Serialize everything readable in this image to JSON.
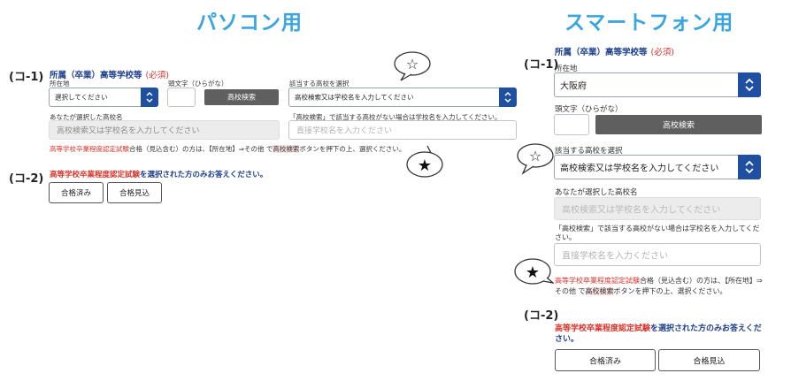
{
  "headings": {
    "pc": "パソコン用",
    "sp": "スマートフォン用"
  },
  "markers": {
    "k1": "(コ-1)",
    "k2": "(コ-2)"
  },
  "section1": {
    "title": "所属（卒業）高等学校等",
    "required": "(必須)",
    "prefecture_label": "所在地",
    "prefecture_value_pc": "選択してください",
    "prefecture_value_sp": "大阪府",
    "initial_label": "頭文字（ひらがな）",
    "search_button": "高校検索",
    "school_select_label": "該当する高校を選択",
    "school_select_value": "高校検索又は学校名を入力してください",
    "selected_label": "あなたが選択した高校名",
    "selected_placeholder": "高校検索又は学校名を入力してください",
    "direct_hint": "「高校検索」で該当する高校がない場合は学校名を入力してください。",
    "direct_placeholder": "直接学校名を入力ください",
    "note_red": "高等学校卒業程度認定試験",
    "note_mid": "合格（見込含む）の方は、【所在地】⇒その他 で",
    "note_hl": "高校検索",
    "note_end": "ボタンを押下の上、選択ください。"
  },
  "section2": {
    "lead_red": "高等学校卒業程度認定試験",
    "lead_rest": "を選択された方のみお答えください。",
    "btn_passed": "合格済み",
    "btn_expected": "合格見込"
  },
  "bubbles": {
    "open": "☆",
    "filled": "★"
  }
}
